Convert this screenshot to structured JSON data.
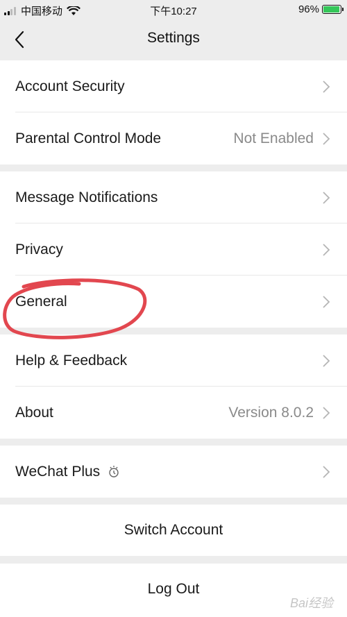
{
  "status_bar": {
    "carrier": "中国移动",
    "time": "下午10:27",
    "battery": "96%",
    "battery_level": 0.96
  },
  "nav": {
    "title": "Settings"
  },
  "groups": [
    {
      "items": [
        {
          "label": "Account Security",
          "value": ""
        },
        {
          "label": "Parental Control Mode",
          "value": "Not Enabled"
        }
      ]
    },
    {
      "items": [
        {
          "label": "Message Notifications",
          "value": ""
        },
        {
          "label": "Privacy",
          "value": ""
        },
        {
          "label": "General",
          "value": ""
        }
      ]
    },
    {
      "items": [
        {
          "label": "Help & Feedback",
          "value": ""
        },
        {
          "label": "About",
          "value": "Version 8.0.2"
        }
      ]
    },
    {
      "items": [
        {
          "label": "WeChat Plus",
          "value": ""
        }
      ]
    }
  ],
  "actions": {
    "switch_account": "Switch Account",
    "log_out": "Log Out"
  },
  "annotation": {
    "color": "#e2474f"
  },
  "watermark": "Bai经验"
}
